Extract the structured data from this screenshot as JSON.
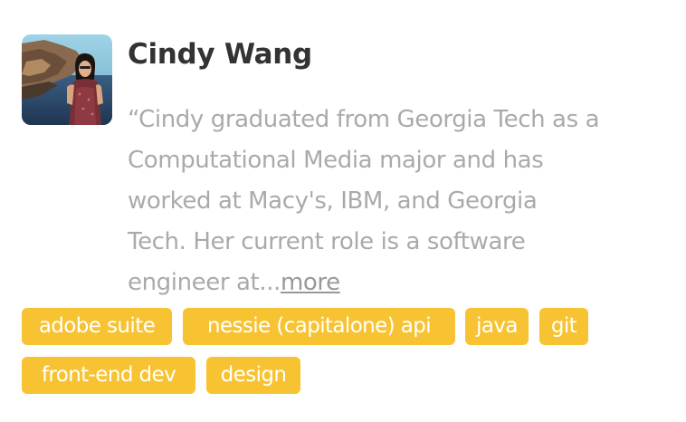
{
  "profile": {
    "name": "Cindy Wang",
    "bio_lines": [
      "“Cindy graduated from Georgia Tech as a",
      "Computational Media major and has",
      "worked at Macy's, IBM, and Georgia",
      "Tech. Her current role is a software",
      "engineer at..."
    ],
    "more_label": "more"
  },
  "tags": [
    "adobe suite",
    "nessie (capitalone) api",
    "java",
    "git",
    "front-end dev",
    "design"
  ],
  "colors": {
    "tag_background": "#f7c332",
    "tag_text": "#ffffff",
    "name_text": "#333333",
    "bio_text": "#aaaaaa"
  }
}
